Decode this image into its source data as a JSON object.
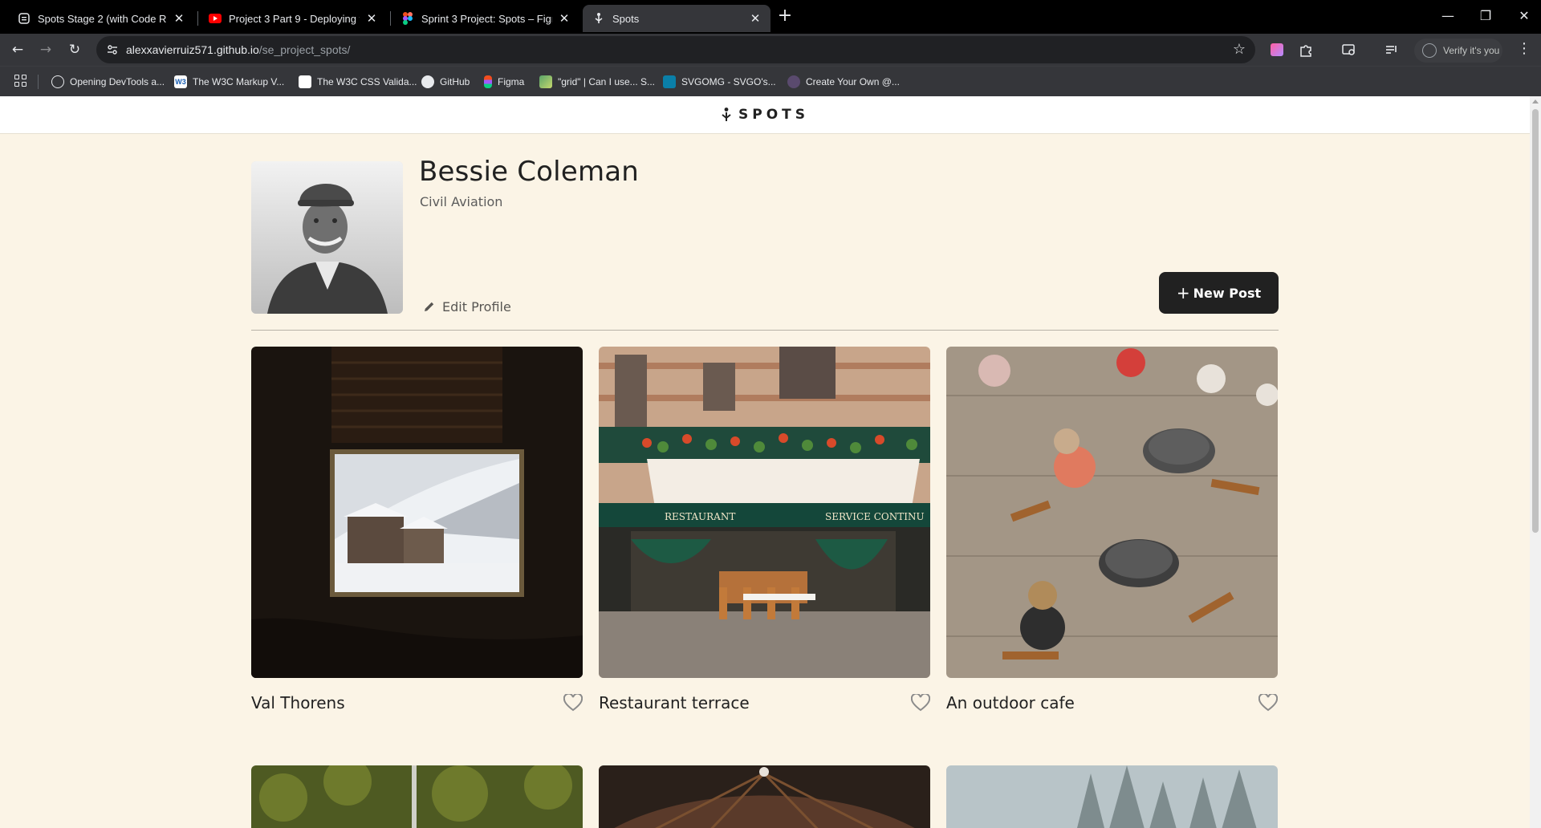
{
  "browser": {
    "tabs": [
      {
        "title": "Spots Stage 2 (with Code Revie",
        "favicon": "document-icon",
        "active": false
      },
      {
        "title": "Project 3 Part 9 - Deploying to G",
        "favicon": "youtube-icon",
        "active": false
      },
      {
        "title": "Sprint 3 Project: Spots – Figma",
        "favicon": "figma-icon",
        "active": false
      },
      {
        "title": "Spots",
        "favicon": "spots-icon",
        "active": true
      }
    ],
    "address": {
      "host": "alexxavierruiz571.github.io",
      "path": "/se_project_spots/"
    },
    "profile_button": "Verify it's you",
    "bookmarks": [
      {
        "label": "Opening DevTools a..."
      },
      {
        "label": "The W3C Markup V..."
      },
      {
        "label": "The W3C CSS Valida..."
      },
      {
        "label": "GitHub"
      },
      {
        "label": "Figma"
      },
      {
        "label": "\"grid\" | Can I use... S..."
      },
      {
        "label": "SVGOMG - SVGO's..."
      },
      {
        "label": "Create Your Own @..."
      }
    ]
  },
  "page": {
    "logo_text": "SPOTS",
    "profile": {
      "name": "Bessie Coleman",
      "description": "Civil Aviation",
      "edit_label": "Edit Profile",
      "new_post_label": "New Post"
    },
    "cards": [
      {
        "title": "Val Thorens"
      },
      {
        "title": "Restaurant terrace"
      },
      {
        "title": "An outdoor cafe"
      }
    ]
  }
}
